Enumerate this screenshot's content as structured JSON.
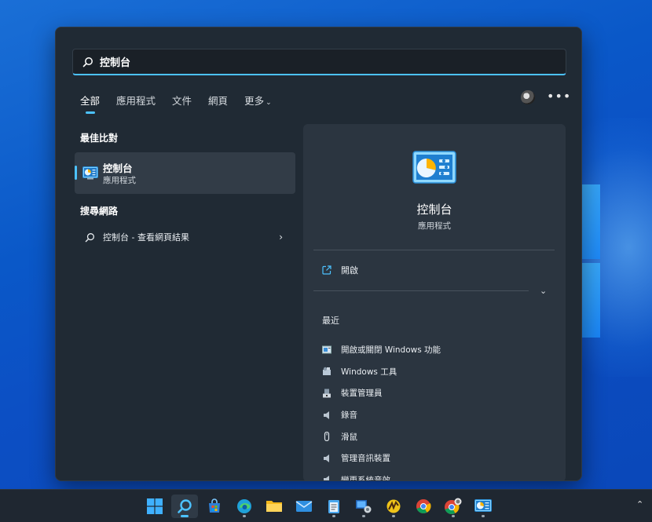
{
  "search": {
    "value": "控制台"
  },
  "tabs": [
    {
      "label": "全部",
      "active": true
    },
    {
      "label": "應用程式"
    },
    {
      "label": "文件"
    },
    {
      "label": "網頁"
    },
    {
      "label": "更多"
    }
  ],
  "sections": {
    "best_match": "最佳比對",
    "search_web": "搜尋網路"
  },
  "best_match": {
    "title": "控制台",
    "subtitle": "應用程式",
    "icon": "control-panel-icon"
  },
  "web_result": {
    "label": "控制台 - 查看網頁結果"
  },
  "details": {
    "title": "控制台",
    "subtitle": "應用程式",
    "open_label": "開啟",
    "recent_label": "最近",
    "recent": [
      {
        "label": "開啟或關閉 Windows 功能",
        "icon": "windows-features-icon"
      },
      {
        "label": "Windows 工具",
        "icon": "windows-tools-icon"
      },
      {
        "label": "裝置管理員",
        "icon": "device-manager-icon"
      },
      {
        "label": "錄音",
        "icon": "speaker-icon"
      },
      {
        "label": "滑鼠",
        "icon": "mouse-icon"
      },
      {
        "label": "管理音訊裝置",
        "icon": "speaker-icon"
      },
      {
        "label": "變更系統音效",
        "icon": "speaker-icon"
      }
    ]
  },
  "taskbar": {
    "apps": [
      "start",
      "search",
      "microsoft-store",
      "edge",
      "file-explorer",
      "mail",
      "notepad",
      "remote-desktop",
      "winrar",
      "chrome",
      "chrome-canary",
      "control-panel"
    ]
  },
  "colors": {
    "accent": "#4cc2ff",
    "panel": "#202a34",
    "detail_pane": "#2b3540"
  }
}
